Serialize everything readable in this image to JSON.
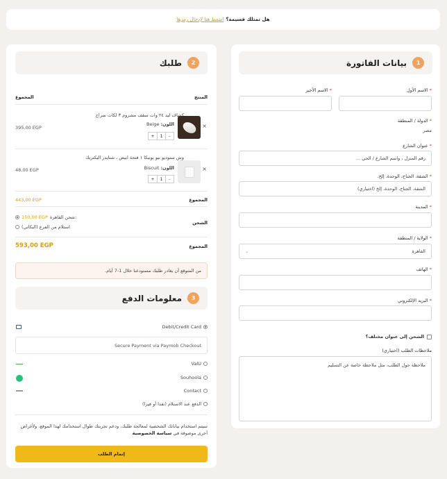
{
  "coupon": {
    "question": "هل تمتلك قسيمة؟",
    "link": "اضغط هنا لإدخال رمزها"
  },
  "billing": {
    "number": "1",
    "title": "بيانات الفاتورة",
    "first_name_label": "الاسم الأول",
    "last_name_label": "الاسم الأخير",
    "country_label": "الدولة / المنطقة",
    "country_value": "مصر",
    "street_label": "عنوان الشارع",
    "street_placeholder": "رقم المنزل ، واسم الشارع / الحي ...",
    "apartment_label": "الشقة، الجناح، الوحدة، إلخ.",
    "apartment_placeholder": "الشقة، الجناح، الوحدة، إلخ (اختياري)",
    "city_label": "المدينة",
    "state_label": "الولاية / المنطقة",
    "state_value": "القاهرة",
    "phone_label": "الهاتف",
    "email_label": "البريد الإلكتروني",
    "ship_different": "الشحن إلى عنوان مختلف؟",
    "notes_label": "ملاحظات الطلب (اختياري)",
    "notes_placeholder": "ملاحظة حول الطلب، مثل ملاحظة خاصة عن التسليم"
  },
  "order": {
    "number": "2",
    "title": "طلبك",
    "col_product": "المنتج",
    "col_total": "المجموع",
    "items": [
      {
        "name": "كشاف ليد ٢٤ وات سقف مشروم ٣ لكات سراج",
        "variant_label": "اللون:",
        "variant": "Beige",
        "qty": "1",
        "price": "395,00 EGP"
      },
      {
        "name": "وش ستوديو نيو يونيكا ١ فتحة ابيض ، شنايدر اليكتريك",
        "variant_label": "اللون:",
        "variant": "Biscuit",
        "qty": "1",
        "price": "48,00 EGP"
      }
    ],
    "subtotal_label": "المجموع",
    "subtotal": "443,00 EGP",
    "shipping_label": "الشحن",
    "shipping_option_1": "شحن القاهرة:",
    "shipping_option_1_price": "150,00 EGP",
    "shipping_option_2": "استلام من الفرع (البكاتي)",
    "total_label": "المجموع",
    "total": "593,00 EGP",
    "notice": "من المتوقع أن يغادر طلبك مستودعنا خلال 1-7 أيام."
  },
  "payment": {
    "number": "3",
    "title": "معلومات الدفع",
    "methods": [
      "Debit/Credit Card",
      "ValU",
      "Souhoola",
      "Contact",
      "الدفع عند الاستلام (نقدا أو فيزا)"
    ],
    "card_note": "Secure Payment via Paymob Checkout",
    "privacy_text": "سيتم استخدام بياناتك الشخصية لمعالجة طلبك، ودعم تجربتك طوال استخدامك لهذا الموقع، ولأغراض أخرى موصوفة في",
    "privacy_link": "سياسة الخصوصية",
    "place_order": "إتمام الطلب"
  },
  "colors": {
    "accent": "#f0b819",
    "step": "#f0a35c",
    "link": "#d89d12"
  }
}
